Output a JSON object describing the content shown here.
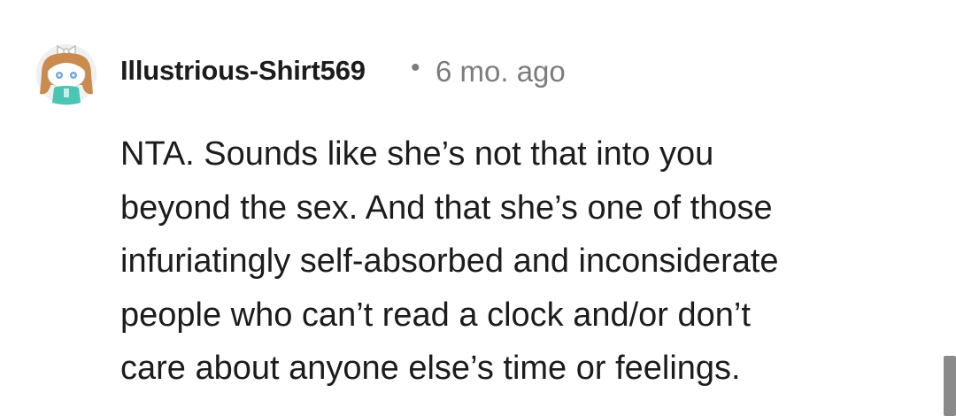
{
  "comment": {
    "author": "Illustrious-Shirt569",
    "separator": "•",
    "timestamp": "6 mo. ago",
    "avatar_icon": "snoo-avatar-icon",
    "body_lines": [
      "NTA. Sounds like she’s not that into you",
      "beyond the sex. And that she’s one of those",
      "infuriatingly self-absorbed and inconsiderate",
      "people who can’t read a clock and/or don’t",
      "care about anyone else’s time or feelings."
    ]
  },
  "colors": {
    "text": "#1c1c1c",
    "meta": "#7c7c7c",
    "avatar_hair": "#c98b4e",
    "avatar_shirt": "#49c6b4",
    "scrollbar": "#8a8a8a"
  }
}
